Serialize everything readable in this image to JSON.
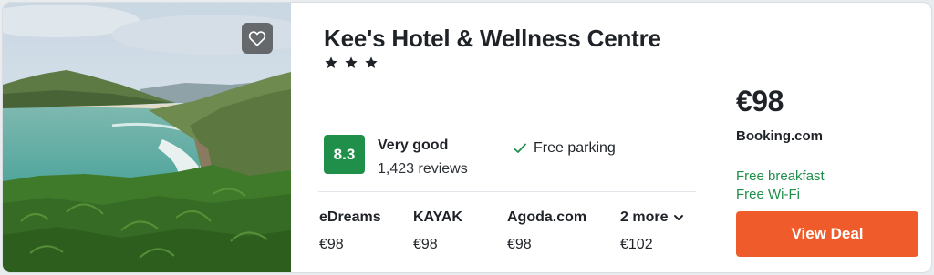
{
  "hotel": {
    "name": "Kee's Hotel & Wellness Centre",
    "star_rating": 3,
    "score": "8.3",
    "rating_label": "Very good",
    "review_count": "1,423 reviews",
    "amenities": [
      "Free parking"
    ]
  },
  "providers": [
    {
      "name": "eDreams",
      "price": "€98"
    },
    {
      "name": "KAYAK",
      "price": "€98"
    },
    {
      "name": "Agoda.com",
      "price": "€98"
    },
    {
      "name": "2 more",
      "price": "€102"
    }
  ],
  "best_deal": {
    "price": "€98",
    "provider": "Booking.com",
    "perks": [
      "Free breakfast",
      "Free Wi-Fi"
    ],
    "button_label": "View Deal"
  },
  "colors": {
    "score_badge": "#1f8f4a",
    "perk_text": "#1f8f4a",
    "cta": "#ef5b2a"
  },
  "icons": {
    "favorite": "heart-icon",
    "star": "star-icon",
    "amenity": "check-icon",
    "more": "chevron-down-icon"
  }
}
